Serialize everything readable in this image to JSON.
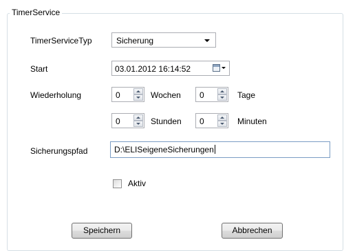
{
  "group": {
    "title": "TimerService"
  },
  "timer_type": {
    "label": "TimerServiceTyp",
    "selected": "Sicherung"
  },
  "start": {
    "label": "Start",
    "value": "03.01.2012 16:14:52"
  },
  "repeat": {
    "label": "Wiederholung",
    "weeks": {
      "value": "0",
      "unit": "Wochen"
    },
    "days": {
      "value": "0",
      "unit": "Tage"
    },
    "hours": {
      "value": "0",
      "unit": "Stunden"
    },
    "minutes": {
      "value": "0",
      "unit": "Minuten"
    }
  },
  "backup_path": {
    "label": "Sicherungspfad",
    "value": "D:\\ELISeigeneSicherungen"
  },
  "active": {
    "label": "Aktiv",
    "checked": false
  },
  "buttons": {
    "save": "Speichern",
    "cancel": "Abbrechen"
  }
}
